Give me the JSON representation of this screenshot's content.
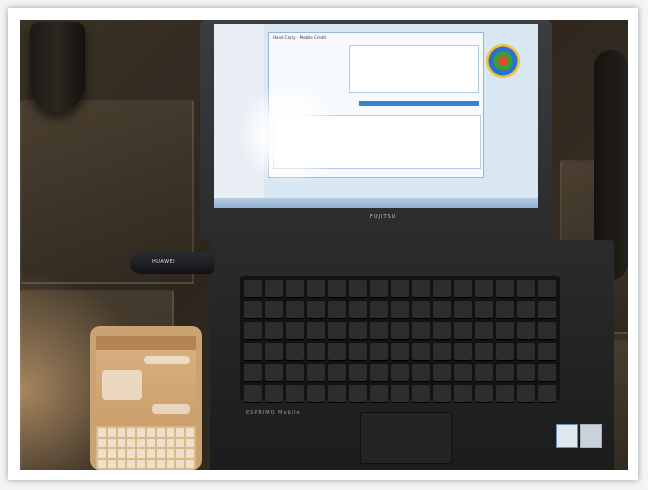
{
  "photo": {
    "subject": "laptop with USB modem and smartphone on tiled floor"
  },
  "laptop": {
    "lid_brand": "FUJITSU",
    "base_brand": "ESPRIMO Mobile",
    "screen": {
      "dialog_title": "Hand Carry - Mobile Credit"
    },
    "keyboard_rows": 6
  },
  "modem": {
    "label": "HUAWEI"
  },
  "phone": {
    "app": "chat"
  }
}
